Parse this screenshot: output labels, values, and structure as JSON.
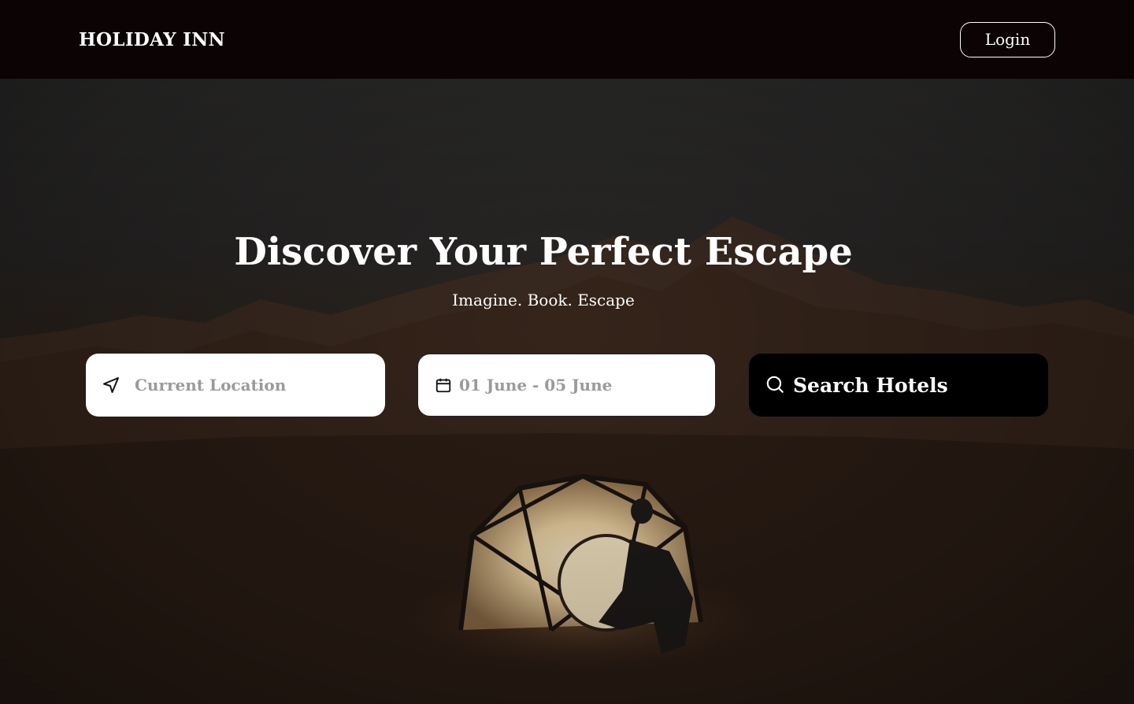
{
  "header": {
    "brand": "HOLIDAY INN",
    "login_label": "Login"
  },
  "hero": {
    "title": "Discover Your Perfect Escape",
    "subtitle": "Imagine. Book. Escape"
  },
  "search": {
    "location_placeholder": "Current Location",
    "dates_placeholder": "01 June - 05 June",
    "button_label": "Search Hotels"
  },
  "icons": {
    "location": "navigation-arrow-icon",
    "dates": "calendar-icon",
    "search": "search-icon"
  },
  "colors": {
    "header_bg": "#0b0304",
    "button_bg": "#000000",
    "field_bg": "#ffffff",
    "placeholder": "#9a9a9a"
  }
}
